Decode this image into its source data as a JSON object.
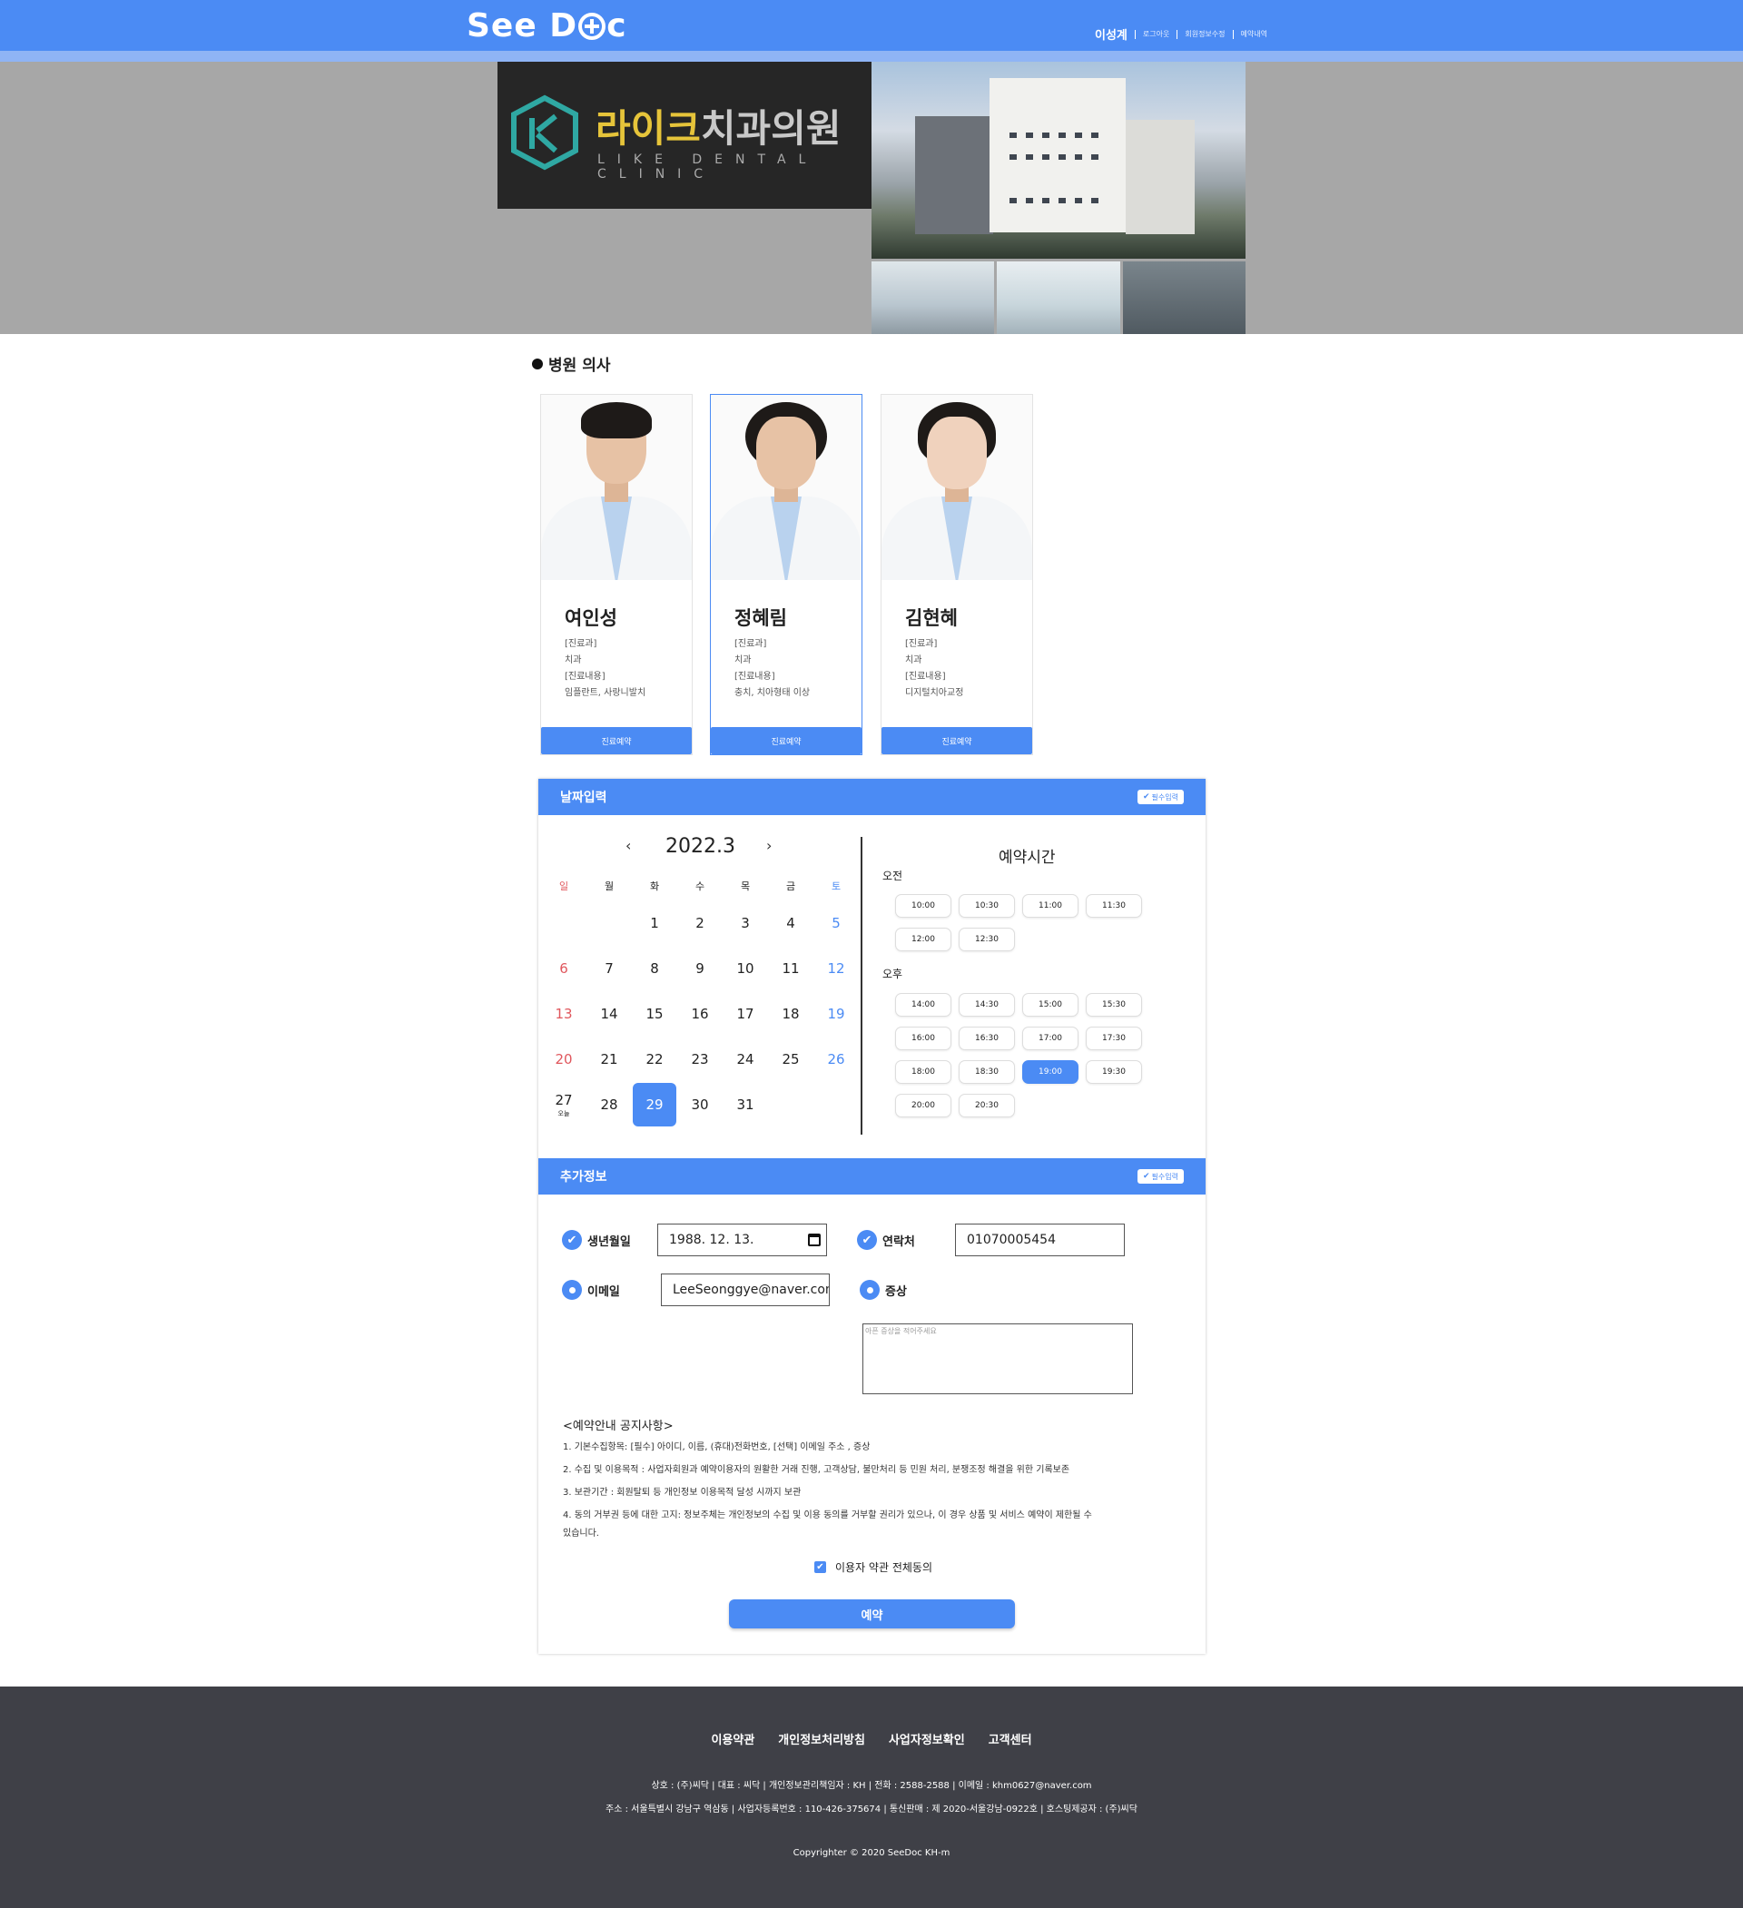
{
  "header": {
    "brand": "See Doc",
    "brand_part1": "See D",
    "brand_part2": "c",
    "user": "이성계",
    "links": [
      "로그아웃",
      "회원정보수정",
      "예약내역"
    ]
  },
  "hero": {
    "clinic_name_1": "라이크",
    "clinic_name_2": "치과의원",
    "clinic_sub": "LIKE DENTAL CLINIC",
    "photo_mark": "라이크치과"
  },
  "doctors": {
    "title": "병원 의사",
    "items": [
      {
        "name": "여인성",
        "dept_label": "[진료과]",
        "dept": "치과",
        "content_label": "[진료내용]",
        "content": "임플란트, 사랑니발치",
        "button": "진료예약"
      },
      {
        "name": "정혜림",
        "dept_label": "[진료과]",
        "dept": "치과",
        "content_label": "[진료내용]",
        "content": "충치, 치아형태 이상",
        "button": "진료예약"
      },
      {
        "name": "김현혜",
        "dept_label": "[진료과]",
        "dept": "치과",
        "content_label": "[진료내용]",
        "content": "디지털치아교정",
        "button": "진료예약"
      }
    ],
    "selected_index": 1
  },
  "date_section": {
    "title": "날짜입력",
    "badge": "필수입력"
  },
  "calendar": {
    "prev": "‹",
    "next": "›",
    "title": "2022.3",
    "weekdays": [
      "일",
      "월",
      "화",
      "수",
      "목",
      "금",
      "토"
    ],
    "weeks": [
      [
        "",
        "",
        "1",
        "2",
        "3",
        "4",
        "5"
      ],
      [
        "6",
        "7",
        "8",
        "9",
        "10",
        "11",
        "12"
      ],
      [
        "13",
        "14",
        "15",
        "16",
        "17",
        "18",
        "19"
      ],
      [
        "20",
        "21",
        "22",
        "23",
        "24",
        "25",
        "26"
      ],
      [
        "27",
        "28",
        "29",
        "30",
        "31",
        "",
        ""
      ]
    ],
    "today": "27",
    "today_label": "오늘",
    "selected": "29"
  },
  "times": {
    "title": "예약시간",
    "am_label": "오전",
    "pm_label": "오후",
    "am": [
      "10:00",
      "10:30",
      "11:00",
      "11:30",
      "12:00",
      "12:30"
    ],
    "pm": [
      "14:00",
      "14:30",
      "15:00",
      "15:30",
      "16:00",
      "16:30",
      "17:00",
      "17:30",
      "18:00",
      "18:30",
      "19:00",
      "19:30",
      "20:00",
      "20:30"
    ],
    "selected": "19:00"
  },
  "extra": {
    "title": "추가정보",
    "badge": "필수입력",
    "birth_label": "생년월일",
    "birth_value": "1988. 12. 13.",
    "phone_label": "연락처",
    "phone_value": "01070005454",
    "email_label": "이메일",
    "email_value": "LeeSeonggye@naver.com",
    "symptom_label": "증상",
    "symptom_placeholder": "아픈 증상을 적어주세요"
  },
  "notice": {
    "title": "<예약안내 공지사항>",
    "lines": [
      "1. 기본수집항목: [필수] 아이디, 이름, (휴대)전화번호, [선택] 이메일 주소 , 증상",
      "2. 수집 및 이용목적 : 사업자회원과 예약이용자의 원활한 거래 진행, 고객상담, 불만처리 등 민원 처리, 분쟁조정 해결을 위한 기록보존",
      "3. 보관기간 : 회원탈퇴 등 개인정보 이용목적 달성 시까지 보관",
      "4. 동의 거부권 등에 대한 고지: 정보주체는 개인정보의 수집 및 이용 동의를 거부할 권리가 있으나, 이 경우 상품 및 서비스 예약이 제한될 수",
      "있습니다."
    ],
    "agree_label": "이용자 약관 전체동의",
    "submit": "예약"
  },
  "footer": {
    "links": [
      "이용약관",
      "개인정보처리방침",
      "사업자정보확인",
      "고객센터"
    ],
    "line1": "상호 : (주)씨닥 | 대표 : 씨닥 | 개인정보관리책임자 : KH | 전화 : 2588-2588 | 이메일 : khm0627@naver.com",
    "line2": "주소 : 서울특별시 강남구 역삼동 | 사업자등록번호 : 110-426-375674 | 통신판매 : 제 2020-서울강남-0922호 | 호스팅제공자 : (주)씨닥",
    "copyright": "Copyrighter © 2020 SeeDoc KH-m"
  },
  "colors": {
    "accent": "#4b8bf4",
    "sunday": "#e0575d",
    "footer_bg": "#3f4047"
  }
}
